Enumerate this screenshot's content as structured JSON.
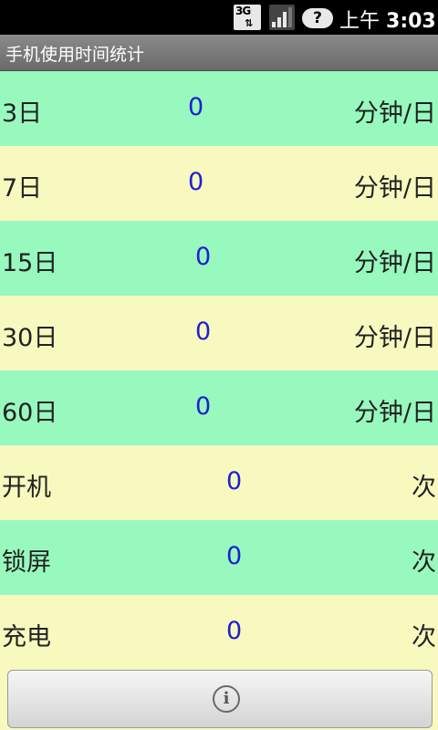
{
  "status_bar": {
    "network": "3G",
    "time_prefix": "上午",
    "time": "3:03",
    "help_icon": "help-question-icon",
    "signal_icon": "signal-strength-icon"
  },
  "title": "手机使用时间统计",
  "rows": [
    {
      "label": "3日",
      "value": "0",
      "unit": "分钟/日"
    },
    {
      "label": "7日",
      "value": "0",
      "unit": "分钟/日"
    },
    {
      "label": "15日",
      "value": "0",
      "unit": "分钟/日"
    },
    {
      "label": "30日",
      "value": "0",
      "unit": "分钟/日"
    },
    {
      "label": "60日",
      "value": "0",
      "unit": "分钟/日"
    },
    {
      "label": "开机",
      "value": "0",
      "unit": "次"
    },
    {
      "label": "锁屏",
      "value": "0",
      "unit": "次"
    },
    {
      "label": "充电",
      "value": "0",
      "unit": "次"
    }
  ],
  "info_button": {
    "icon": "info-icon",
    "glyph": "i"
  },
  "colors": {
    "row_green": "#97f9be",
    "row_yellow": "#f7f9bf",
    "value_blue": "#2020d0"
  }
}
